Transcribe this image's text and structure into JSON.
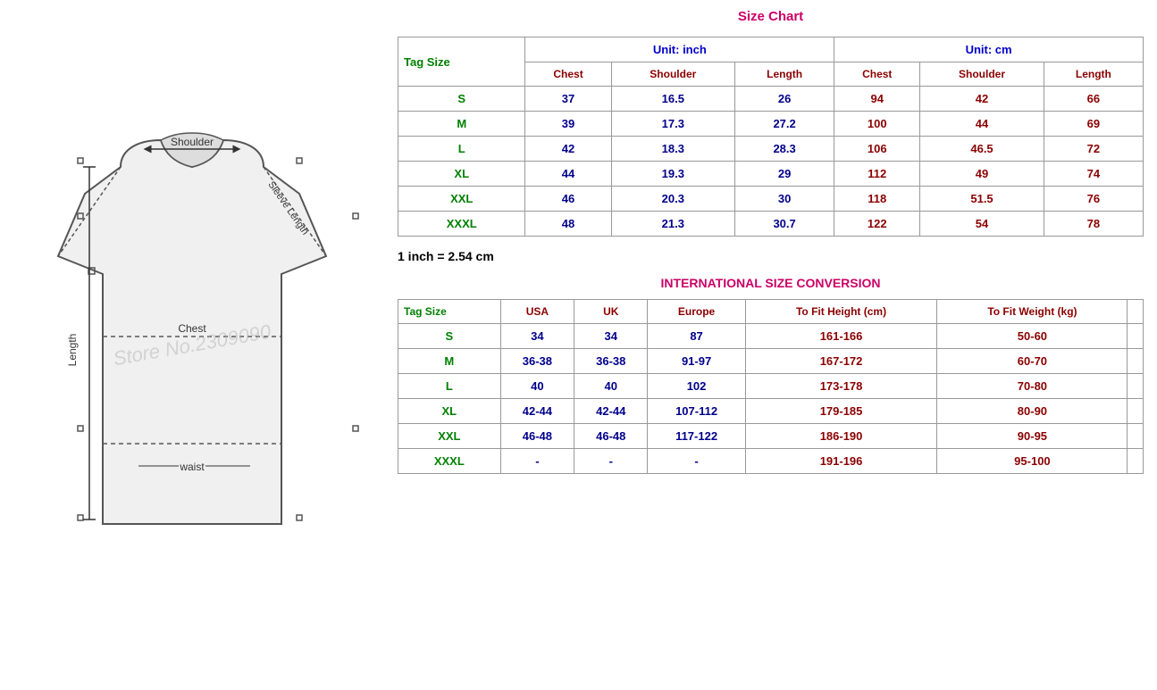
{
  "leftPanel": {
    "watermark": "Store No.2309090"
  },
  "sizeChart": {
    "title": "Size Chart",
    "unitInch": "Unit: inch",
    "unitCm": "Unit: cm",
    "tagSizeLabel": "Tag Size",
    "headers": {
      "chest": "Chest",
      "shoulder": "Shoulder",
      "length": "Length"
    },
    "rows": [
      {
        "tag": "S",
        "inchChest": "37",
        "inchShoulder": "16.5",
        "inchLength": "26",
        "cmChest": "94",
        "cmShoulder": "42",
        "cmLength": "66"
      },
      {
        "tag": "M",
        "inchChest": "39",
        "inchShoulder": "17.3",
        "inchLength": "27.2",
        "cmChest": "100",
        "cmShoulder": "44",
        "cmLength": "69"
      },
      {
        "tag": "L",
        "inchChest": "42",
        "inchShoulder": "18.3",
        "inchLength": "28.3",
        "cmChest": "106",
        "cmShoulder": "46.5",
        "cmLength": "72"
      },
      {
        "tag": "XL",
        "inchChest": "44",
        "inchShoulder": "19.3",
        "inchLength": "29",
        "cmChest": "112",
        "cmShoulder": "49",
        "cmLength": "74"
      },
      {
        "tag": "XXL",
        "inchChest": "46",
        "inchShoulder": "20.3",
        "inchLength": "30",
        "cmChest": "118",
        "cmShoulder": "51.5",
        "cmLength": "76"
      },
      {
        "tag": "XXXL",
        "inchChest": "48",
        "inchShoulder": "21.3",
        "inchLength": "30.7",
        "cmChest": "122",
        "cmShoulder": "54",
        "cmLength": "78"
      }
    ],
    "conversionNote": "1 inch = 2.54 cm"
  },
  "intlConversion": {
    "title": "INTERNATIONAL SIZE CONVERSION",
    "tagSizeLabel": "Tag Size",
    "headers": {
      "usa": "USA",
      "uk": "UK",
      "europe": "Europe",
      "toFitHeight": "To Fit Height (cm)",
      "toFitWeight": "To Fit Weight (kg)"
    },
    "rows": [
      {
        "tag": "S",
        "usa": "34",
        "uk": "34",
        "europe": "87",
        "height": "161-166",
        "weight": "50-60"
      },
      {
        "tag": "M",
        "usa": "36-38",
        "uk": "36-38",
        "europe": "91-97",
        "height": "167-172",
        "weight": "60-70"
      },
      {
        "tag": "L",
        "usa": "40",
        "uk": "40",
        "europe": "102",
        "height": "173-178",
        "weight": "70-80"
      },
      {
        "tag": "XL",
        "usa": "42-44",
        "uk": "42-44",
        "europe": "107-112",
        "height": "179-185",
        "weight": "80-90"
      },
      {
        "tag": "XXL",
        "usa": "46-48",
        "uk": "46-48",
        "europe": "117-122",
        "height": "186-190",
        "weight": "90-95"
      },
      {
        "tag": "XXXL",
        "usa": "-",
        "uk": "-",
        "europe": "-",
        "height": "191-196",
        "weight": "95-100"
      }
    ]
  }
}
